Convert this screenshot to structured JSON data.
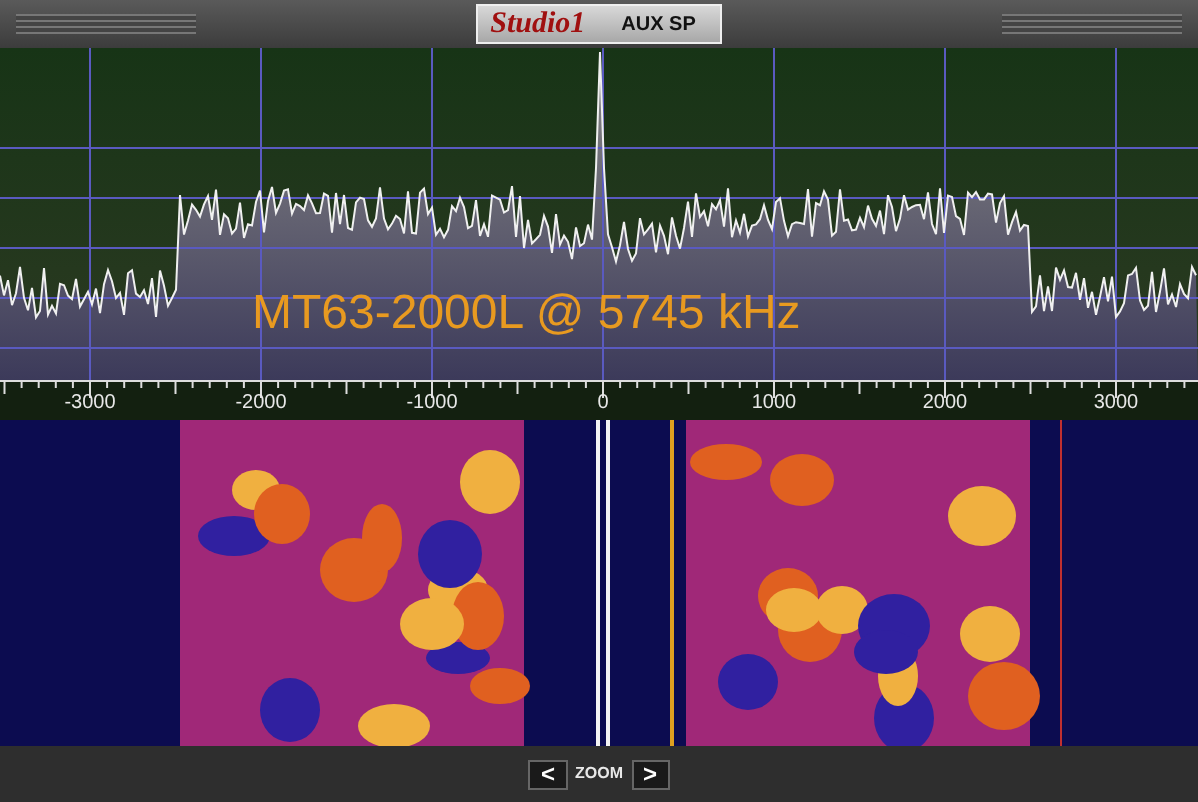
{
  "header": {
    "logo": "Studio1",
    "mode": "AUX SP"
  },
  "spectrum": {
    "label": "MT63-2000L @ 5745 kHz"
  },
  "axis": {
    "ticks": [
      "-3000",
      "-2000",
      "-1000",
      "0",
      "1000",
      "2000",
      "3000"
    ]
  },
  "zoom": {
    "prev": "<",
    "label": "ZOOM",
    "next": ">"
  }
}
